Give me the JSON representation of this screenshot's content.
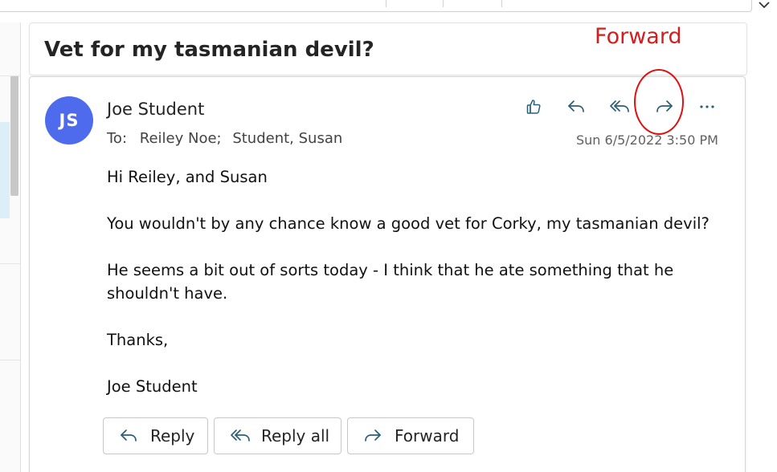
{
  "subject": "Vet for my tasmanian devil?",
  "sender": {
    "initials": "JS",
    "name": "Joe Student",
    "avatar_color": "#4f6bed"
  },
  "recipients": {
    "label": "To:",
    "list": [
      "Reiley Noe;",
      "Student, Susan"
    ]
  },
  "timestamp": "Sun 6/5/2022 3:50 PM",
  "actions": {
    "icons": [
      "like-icon",
      "reply-icon",
      "reply-all-icon",
      "forward-icon",
      "more-icon"
    ]
  },
  "body": {
    "paragraphs": [
      "Hi Reiley, and Susan",
      "You wouldn't by any chance know a good vet for Corky, my tasmanian devil?",
      "He seems a bit out of sorts today - I think that he ate something that he shouldn't have.",
      "Thanks,",
      "Joe Student"
    ]
  },
  "footer_buttons": {
    "reply": "Reply",
    "reply_all": "Reply all",
    "forward": "Forward"
  },
  "annotation": {
    "label": "Forward",
    "color": "#d21e1e"
  }
}
